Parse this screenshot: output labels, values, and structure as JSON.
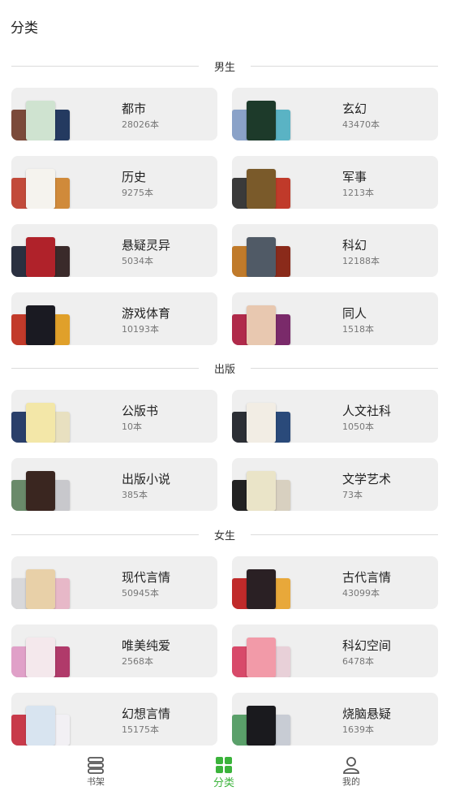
{
  "header": {
    "title": "分类"
  },
  "sections": [
    {
      "label": "男生",
      "items": [
        {
          "name": "都市",
          "count": "28026本",
          "colors": [
            "#7b4a3a",
            "#cfe3d0",
            "#243a60"
          ]
        },
        {
          "name": "玄幻",
          "count": "43470本",
          "colors": [
            "#8aa2c8",
            "#1d3a2a",
            "#5ab3c4"
          ]
        },
        {
          "name": "历史",
          "count": "9275本",
          "colors": [
            "#c24a3a",
            "#f5f3ee",
            "#d08a3a"
          ]
        },
        {
          "name": "军事",
          "count": "1213本",
          "colors": [
            "#3a3a3a",
            "#7a5a2a",
            "#c03a2a"
          ]
        },
        {
          "name": "悬疑灵异",
          "count": "5034本",
          "colors": [
            "#2a3040",
            "#b0222a",
            "#3a2a2a"
          ]
        },
        {
          "name": "科幻",
          "count": "12188本",
          "colors": [
            "#c07a2a",
            "#505a66",
            "#8a2a1a"
          ]
        },
        {
          "name": "游戏体育",
          "count": "10193本",
          "colors": [
            "#c23a2a",
            "#1a1a22",
            "#e0a02a"
          ]
        },
        {
          "name": "同人",
          "count": "1518本",
          "colors": [
            "#b02a4a",
            "#e8c8b0",
            "#7a2a6a"
          ]
        }
      ]
    },
    {
      "label": "出版",
      "items": [
        {
          "name": "公版书",
          "count": "10本",
          "colors": [
            "#2a3f6a",
            "#f3e7a8",
            "#e8e0c0"
          ]
        },
        {
          "name": "人文社科",
          "count": "1050本",
          "colors": [
            "#2c2f35",
            "#f2ede4",
            "#2a4a7a"
          ]
        },
        {
          "name": "出版小说",
          "count": "385本",
          "colors": [
            "#6a8a6a",
            "#3a2620",
            "#c8c8cc"
          ]
        },
        {
          "name": "文学艺术",
          "count": "73本",
          "colors": [
            "#222222",
            "#eae4c8",
            "#d8d0c0"
          ]
        }
      ]
    },
    {
      "label": "女生",
      "items": [
        {
          "name": "现代言情",
          "count": "50945本",
          "colors": [
            "#d8d8da",
            "#e8d0a8",
            "#e7b8c8"
          ]
        },
        {
          "name": "古代言情",
          "count": "43099本",
          "colors": [
            "#c02a2a",
            "#2a2024",
            "#e8a83a"
          ]
        },
        {
          "name": "唯美纯爱",
          "count": "2568本",
          "colors": [
            "#e0a0c8",
            "#f4e8ec",
            "#b03a6a"
          ]
        },
        {
          "name": "科幻空间",
          "count": "6478本",
          "colors": [
            "#d84a6a",
            "#f29aa8",
            "#e8d0d8"
          ]
        },
        {
          "name": "幻想言情",
          "count": "15175本",
          "colors": [
            "#c83a4a",
            "#d8e4f0",
            "#f2f0f4"
          ]
        },
        {
          "name": "烧脑悬疑",
          "count": "1639本",
          "colors": [
            "#5aa06a",
            "#1a1a1e",
            "#c8ccd4"
          ]
        }
      ]
    }
  ],
  "tabbar": {
    "tabs": [
      {
        "label": "书架",
        "icon": "bookshelf-icon",
        "active": false
      },
      {
        "label": "分类",
        "icon": "category-grid-icon",
        "active": true
      },
      {
        "label": "我的",
        "icon": "user-icon",
        "active": false
      }
    ],
    "active_color": "#3bb33b"
  }
}
